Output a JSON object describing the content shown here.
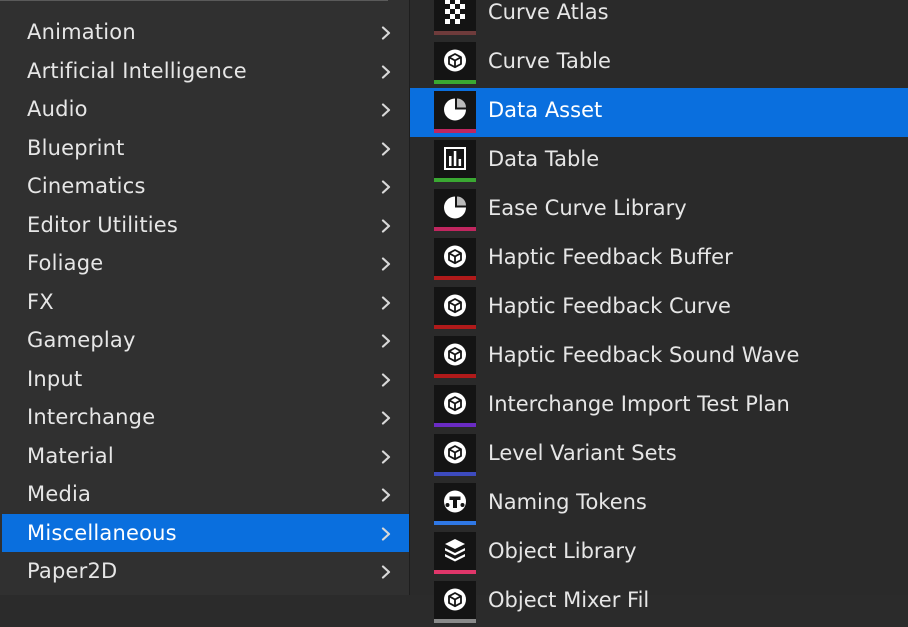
{
  "categories": [
    {
      "label": "Animation"
    },
    {
      "label": "Artificial Intelligence"
    },
    {
      "label": "Audio"
    },
    {
      "label": "Blueprint"
    },
    {
      "label": "Cinematics"
    },
    {
      "label": "Editor Utilities"
    },
    {
      "label": "Foliage"
    },
    {
      "label": "FX"
    },
    {
      "label": "Gameplay"
    },
    {
      "label": "Input"
    },
    {
      "label": "Interchange"
    },
    {
      "label": "Material"
    },
    {
      "label": "Media"
    },
    {
      "label": "Miscellaneous",
      "selected": true
    },
    {
      "label": "Paper2D"
    }
  ],
  "assets": [
    {
      "label": "Curve Atlas",
      "icon": "checker-icon",
      "color": "#6e3b3b"
    },
    {
      "label": "Curve Table",
      "icon": "cube-icon",
      "color": "#3aa832"
    },
    {
      "label": "Data Asset",
      "icon": "pie-icon",
      "color": "#c0265f",
      "selected": true
    },
    {
      "label": "Data Table",
      "icon": "bar-chart-icon",
      "color": "#3aa832"
    },
    {
      "label": "Ease Curve Library",
      "icon": "pie-icon",
      "color": "#c0265f"
    },
    {
      "label": "Haptic Feedback Buffer",
      "icon": "cube-icon",
      "color": "#b01a1a"
    },
    {
      "label": "Haptic Feedback Curve",
      "icon": "cube-icon",
      "color": "#b01a1a"
    },
    {
      "label": "Haptic Feedback Sound Wave",
      "icon": "cube-icon",
      "color": "#b01a1a"
    },
    {
      "label": "Interchange Import Test Plan",
      "icon": "cube-icon",
      "color": "#6a2bc4"
    },
    {
      "label": "Level Variant Sets",
      "icon": "cube-icon",
      "color": "#3d4bbf"
    },
    {
      "label": "Naming Tokens",
      "icon": "token-icon",
      "color": "#2f78e6"
    },
    {
      "label": "Object Library",
      "icon": "stack-icon",
      "color": "#e0366a"
    },
    {
      "label": "Object Mixer Fil",
      "icon": "cube-icon",
      "color": "#8a8a8a"
    }
  ],
  "colors": {
    "selection": "#0a6fde"
  }
}
